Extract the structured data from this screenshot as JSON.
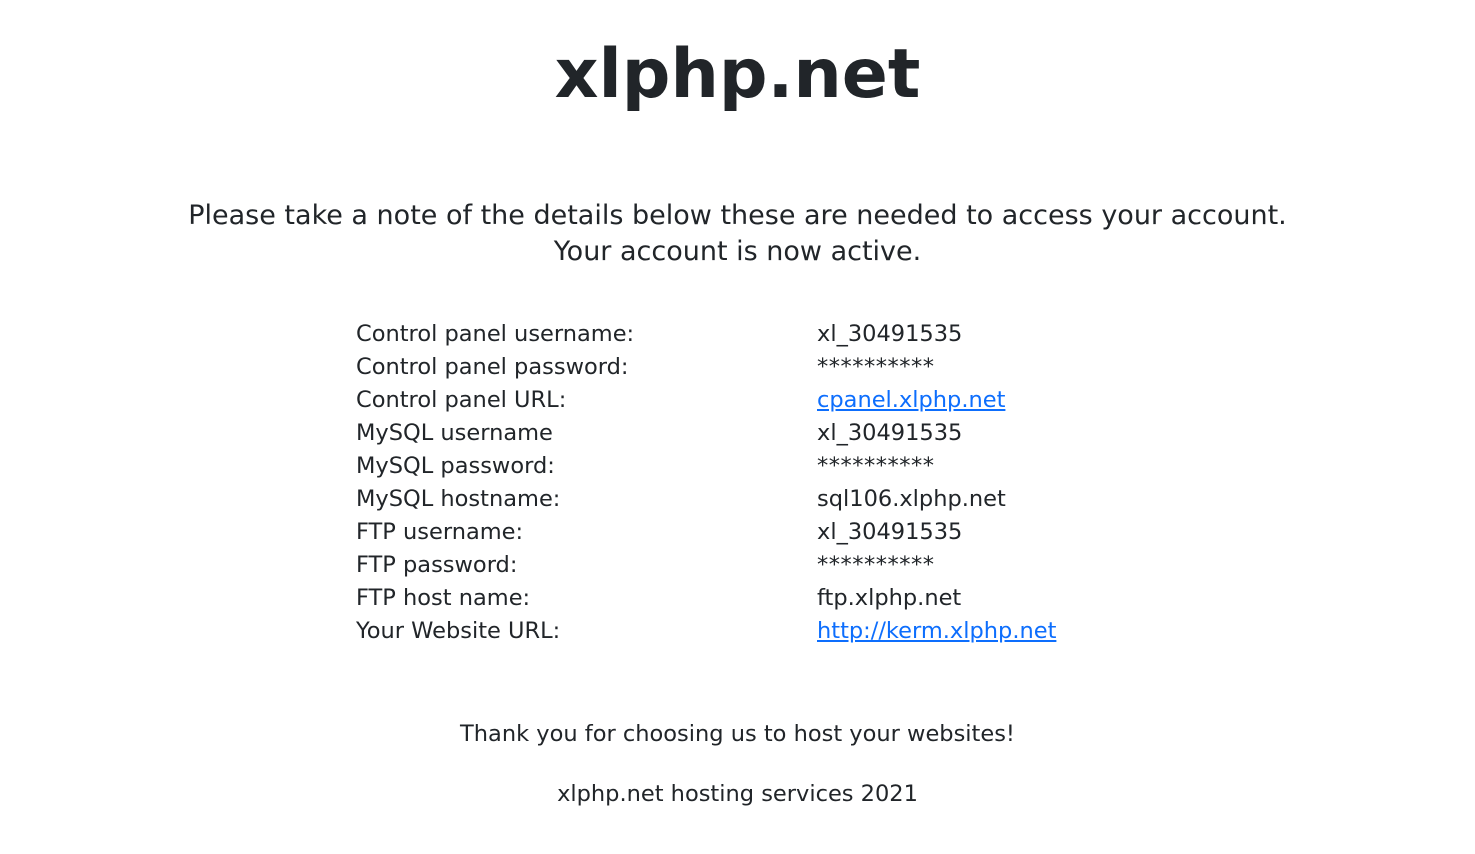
{
  "site": {
    "title": "xlphp.net"
  },
  "intro": {
    "line1": "Please take a note of the details below these are needed to access your account.",
    "line2": "Your account is now active."
  },
  "details": {
    "rows": [
      {
        "label": "Control panel username:",
        "value": "xl_30491535"
      },
      {
        "label": "Control panel password:",
        "value": "**********"
      },
      {
        "label": "Control panel URL:",
        "value": "cpanel.xlphp.net"
      },
      {
        "label": "MySQL username",
        "value": "xl_30491535"
      },
      {
        "label": "MySQL password:",
        "value": "**********"
      },
      {
        "label": "MySQL hostname:",
        "value": "sql106.xlphp.net"
      },
      {
        "label": "FTP username:",
        "value": "xl_30491535"
      },
      {
        "label": "FTP password:",
        "value": "**********"
      },
      {
        "label": "FTP host name:",
        "value": "ftp.xlphp.net"
      },
      {
        "label": "Your Website URL:",
        "value": "http://kerm.xlphp.net"
      }
    ]
  },
  "footer": {
    "thanks": "Thank you for choosing us to host your websites!",
    "copyright": "xlphp.net hosting services 2021"
  },
  "colors": {
    "text": "#212529",
    "link": "#0d6efd",
    "background": "#ffffff"
  }
}
